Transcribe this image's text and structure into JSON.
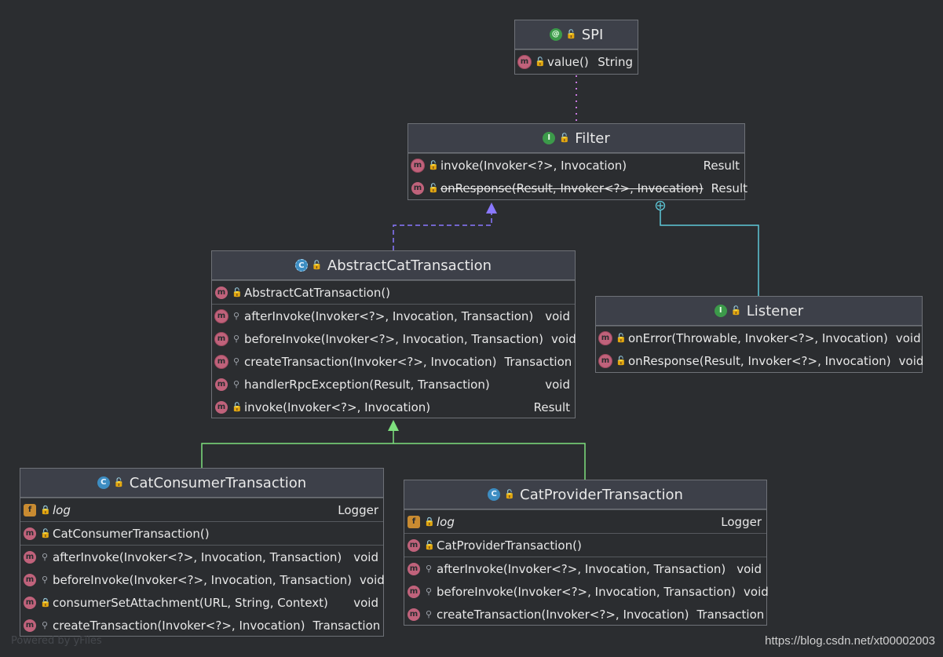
{
  "watermarks": {
    "left": "Powered by yFiles",
    "right": "https://blog.csdn.net/xt00002003"
  },
  "colors": {
    "background": "#2b2d30",
    "header": "#3d4049",
    "border": "#6e7177",
    "annotation_edge": "#c678dd",
    "implements_edge": "#8a78ff",
    "extends_edge": "#7ee07e",
    "inner_edge": "#5ec8d8"
  },
  "classes": {
    "spi": {
      "title": "SPI",
      "kind_icon": "annotation-icon",
      "methods": [
        {
          "name": "value()",
          "ret": "String"
        }
      ]
    },
    "filter": {
      "title": "Filter",
      "kind_icon": "interface-icon",
      "methods": [
        {
          "name": "invoke(Invoker<?>, Invocation)",
          "ret": "Result"
        },
        {
          "name": "onResponse(Result, Invoker<?>, Invocation)",
          "ret": "Result",
          "deprecated": true
        }
      ]
    },
    "abstract_cat": {
      "title": "AbstractCatTransaction",
      "kind_icon": "abstract-class-icon",
      "constructors": [
        {
          "name": "AbstractCatTransaction()"
        }
      ],
      "methods": [
        {
          "name": "afterInvoke(Invoker<?>, Invocation, Transaction)",
          "ret": "void"
        },
        {
          "name": "beforeInvoke(Invoker<?>, Invocation, Transaction)",
          "ret": "void"
        },
        {
          "name": "createTransaction(Invoker<?>, Invocation)",
          "ret": "Transaction"
        },
        {
          "name": "handlerRpcException(Result, Transaction)",
          "ret": "void"
        },
        {
          "name": "invoke(Invoker<?>, Invocation)",
          "ret": "Result"
        }
      ]
    },
    "listener": {
      "title": "Listener",
      "kind_icon": "interface-icon",
      "methods": [
        {
          "name": "onError(Throwable, Invoker<?>, Invocation)",
          "ret": "void"
        },
        {
          "name": "onResponse(Result, Invoker<?>, Invocation)",
          "ret": "void"
        }
      ]
    },
    "consumer": {
      "title": "CatConsumerTransaction",
      "kind_icon": "class-icon",
      "fields": [
        {
          "name": "log",
          "ret": "Logger"
        }
      ],
      "constructors": [
        {
          "name": "CatConsumerTransaction()"
        }
      ],
      "methods": [
        {
          "name": "afterInvoke(Invoker<?>, Invocation, Transaction)",
          "ret": "void"
        },
        {
          "name": "beforeInvoke(Invoker<?>, Invocation, Transaction)",
          "ret": "void"
        },
        {
          "name": "consumerSetAttachment(URL, String, Context)",
          "ret": "void"
        },
        {
          "name": "createTransaction(Invoker<?>, Invocation)",
          "ret": "Transaction"
        }
      ]
    },
    "provider": {
      "title": "CatProviderTransaction",
      "kind_icon": "class-icon",
      "fields": [
        {
          "name": "log",
          "ret": "Logger"
        }
      ],
      "constructors": [
        {
          "name": "CatProviderTransaction()"
        }
      ],
      "methods": [
        {
          "name": "afterInvoke(Invoker<?>, Invocation, Transaction)",
          "ret": "void"
        },
        {
          "name": "beforeInvoke(Invoker<?>, Invocation, Transaction)",
          "ret": "void"
        },
        {
          "name": "createTransaction(Invoker<?>, Invocation)",
          "ret": "Transaction"
        }
      ]
    }
  }
}
